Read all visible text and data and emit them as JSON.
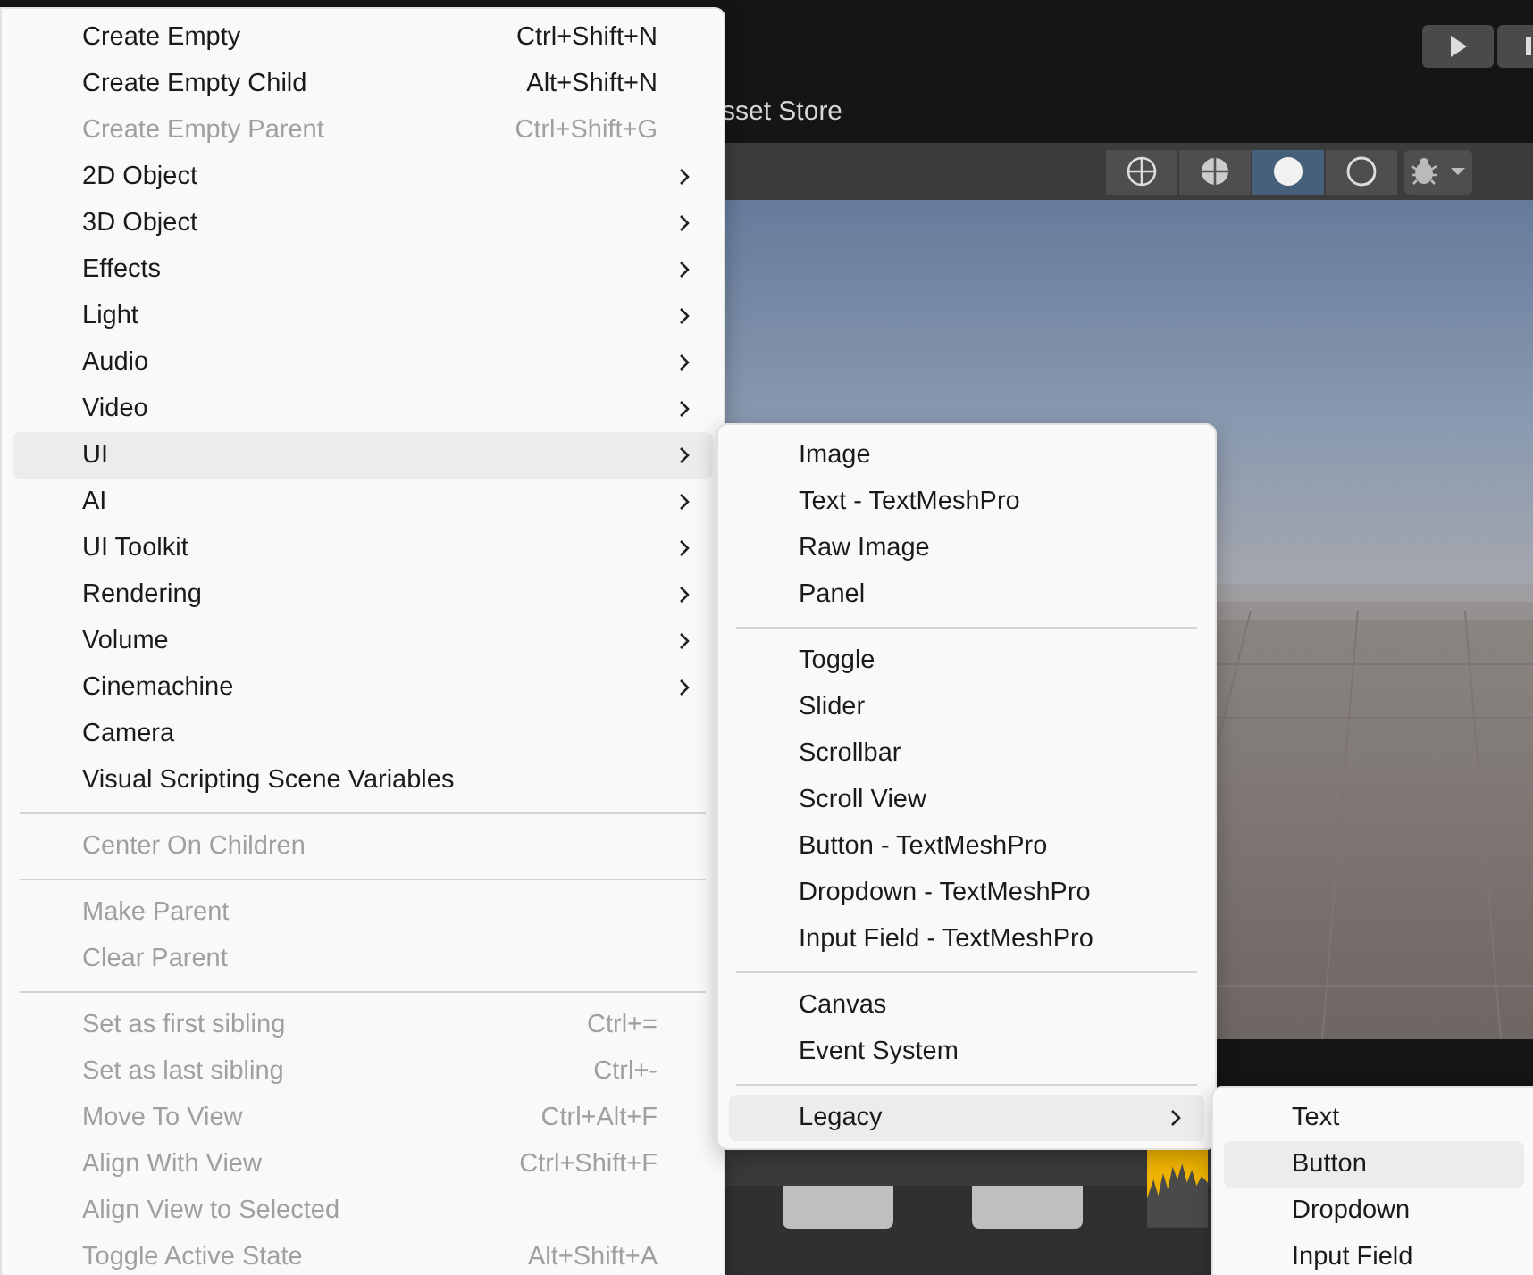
{
  "editor": {
    "tab_label": "sset Store",
    "play_controls": [
      {
        "kind": "play"
      },
      {
        "kind": "pause"
      }
    ],
    "scene_toolbar": [
      {
        "kind": "wireframe",
        "selected": false
      },
      {
        "kind": "shaded-wireframe",
        "selected": false
      },
      {
        "kind": "shaded",
        "selected": true
      },
      {
        "kind": "unlit",
        "selected": false
      }
    ]
  },
  "context_menu": {
    "items": [
      {
        "kind": "item",
        "label": "Create Empty",
        "shortcut": "Ctrl+Shift+N",
        "disabled": false,
        "has_submenu": false,
        "selected": false
      },
      {
        "kind": "item",
        "label": "Create Empty Child",
        "shortcut": "Alt+Shift+N",
        "disabled": false,
        "has_submenu": false,
        "selected": false
      },
      {
        "kind": "item",
        "label": "Create Empty Parent",
        "shortcut": "Ctrl+Shift+G",
        "disabled": true,
        "has_submenu": false,
        "selected": false
      },
      {
        "kind": "item",
        "label": "2D Object",
        "disabled": false,
        "has_submenu": true,
        "selected": false
      },
      {
        "kind": "item",
        "label": "3D Object",
        "disabled": false,
        "has_submenu": true,
        "selected": false
      },
      {
        "kind": "item",
        "label": "Effects",
        "disabled": false,
        "has_submenu": true,
        "selected": false
      },
      {
        "kind": "item",
        "label": "Light",
        "disabled": false,
        "has_submenu": true,
        "selected": false
      },
      {
        "kind": "item",
        "label": "Audio",
        "disabled": false,
        "has_submenu": true,
        "selected": false
      },
      {
        "kind": "item",
        "label": "Video",
        "disabled": false,
        "has_submenu": true,
        "selected": false
      },
      {
        "kind": "item",
        "label": "UI",
        "disabled": false,
        "has_submenu": true,
        "selected": true
      },
      {
        "kind": "item",
        "label": "AI",
        "disabled": false,
        "has_submenu": true,
        "selected": false
      },
      {
        "kind": "item",
        "label": "UI Toolkit",
        "disabled": false,
        "has_submenu": true,
        "selected": false
      },
      {
        "kind": "item",
        "label": "Rendering",
        "disabled": false,
        "has_submenu": true,
        "selected": false
      },
      {
        "kind": "item",
        "label": "Volume",
        "disabled": false,
        "has_submenu": true,
        "selected": false
      },
      {
        "kind": "item",
        "label": "Cinemachine",
        "disabled": false,
        "has_submenu": true,
        "selected": false
      },
      {
        "kind": "item",
        "label": "Camera",
        "disabled": false,
        "has_submenu": false,
        "selected": false
      },
      {
        "kind": "item",
        "label": "Visual Scripting Scene Variables",
        "disabled": false,
        "has_submenu": false,
        "selected": false
      },
      {
        "kind": "separator"
      },
      {
        "kind": "item",
        "label": "Center On Children",
        "disabled": true,
        "has_submenu": false,
        "selected": false
      },
      {
        "kind": "separator"
      },
      {
        "kind": "item",
        "label": "Make Parent",
        "disabled": true,
        "has_submenu": false,
        "selected": false
      },
      {
        "kind": "item",
        "label": "Clear Parent",
        "disabled": true,
        "has_submenu": false,
        "selected": false
      },
      {
        "kind": "separator"
      },
      {
        "kind": "item",
        "label": "Set as first sibling",
        "shortcut": "Ctrl+=",
        "disabled": true,
        "has_submenu": false,
        "selected": false
      },
      {
        "kind": "item",
        "label": "Set as last sibling",
        "shortcut": "Ctrl+-",
        "disabled": true,
        "has_submenu": false,
        "selected": false
      },
      {
        "kind": "item",
        "label": "Move To View",
        "shortcut": "Ctrl+Alt+F",
        "disabled": true,
        "has_submenu": false,
        "selected": false
      },
      {
        "kind": "item",
        "label": "Align With View",
        "shortcut": "Ctrl+Shift+F",
        "disabled": true,
        "has_submenu": false,
        "selected": false
      },
      {
        "kind": "item",
        "label": "Align View to Selected",
        "disabled": true,
        "has_submenu": false,
        "selected": false
      },
      {
        "kind": "item",
        "label": "Toggle Active State",
        "shortcut": "Alt+Shift+A",
        "disabled": true,
        "has_submenu": false,
        "selected": false
      }
    ]
  },
  "ui_submenu": {
    "items": [
      {
        "kind": "item",
        "label": "Image",
        "has_submenu": false,
        "selected": false
      },
      {
        "kind": "item",
        "label": "Text - TextMeshPro",
        "has_submenu": false,
        "selected": false
      },
      {
        "kind": "item",
        "label": "Raw Image",
        "has_submenu": false,
        "selected": false
      },
      {
        "kind": "item",
        "label": "Panel",
        "has_submenu": false,
        "selected": false
      },
      {
        "kind": "separator"
      },
      {
        "kind": "item",
        "label": "Toggle",
        "has_submenu": false,
        "selected": false
      },
      {
        "kind": "item",
        "label": "Slider",
        "has_submenu": false,
        "selected": false
      },
      {
        "kind": "item",
        "label": "Scrollbar",
        "has_submenu": false,
        "selected": false
      },
      {
        "kind": "item",
        "label": "Scroll View",
        "has_submenu": false,
        "selected": false
      },
      {
        "kind": "item",
        "label": "Button - TextMeshPro",
        "has_submenu": false,
        "selected": false
      },
      {
        "kind": "item",
        "label": "Dropdown - TextMeshPro",
        "has_submenu": false,
        "selected": false
      },
      {
        "kind": "item",
        "label": "Input Field - TextMeshPro",
        "has_submenu": false,
        "selected": false
      },
      {
        "kind": "separator"
      },
      {
        "kind": "item",
        "label": "Canvas",
        "has_submenu": false,
        "selected": false
      },
      {
        "kind": "item",
        "label": "Event System",
        "has_submenu": false,
        "selected": false
      },
      {
        "kind": "separator"
      },
      {
        "kind": "item",
        "label": "Legacy",
        "has_submenu": true,
        "selected": true
      }
    ]
  },
  "legacy_submenu": {
    "items": [
      {
        "kind": "item",
        "label": "Text",
        "selected": false
      },
      {
        "kind": "item",
        "label": "Button",
        "selected": true
      },
      {
        "kind": "item",
        "label": "Dropdown",
        "selected": false
      },
      {
        "kind": "item",
        "label": "Input Field",
        "selected": false
      }
    ]
  }
}
